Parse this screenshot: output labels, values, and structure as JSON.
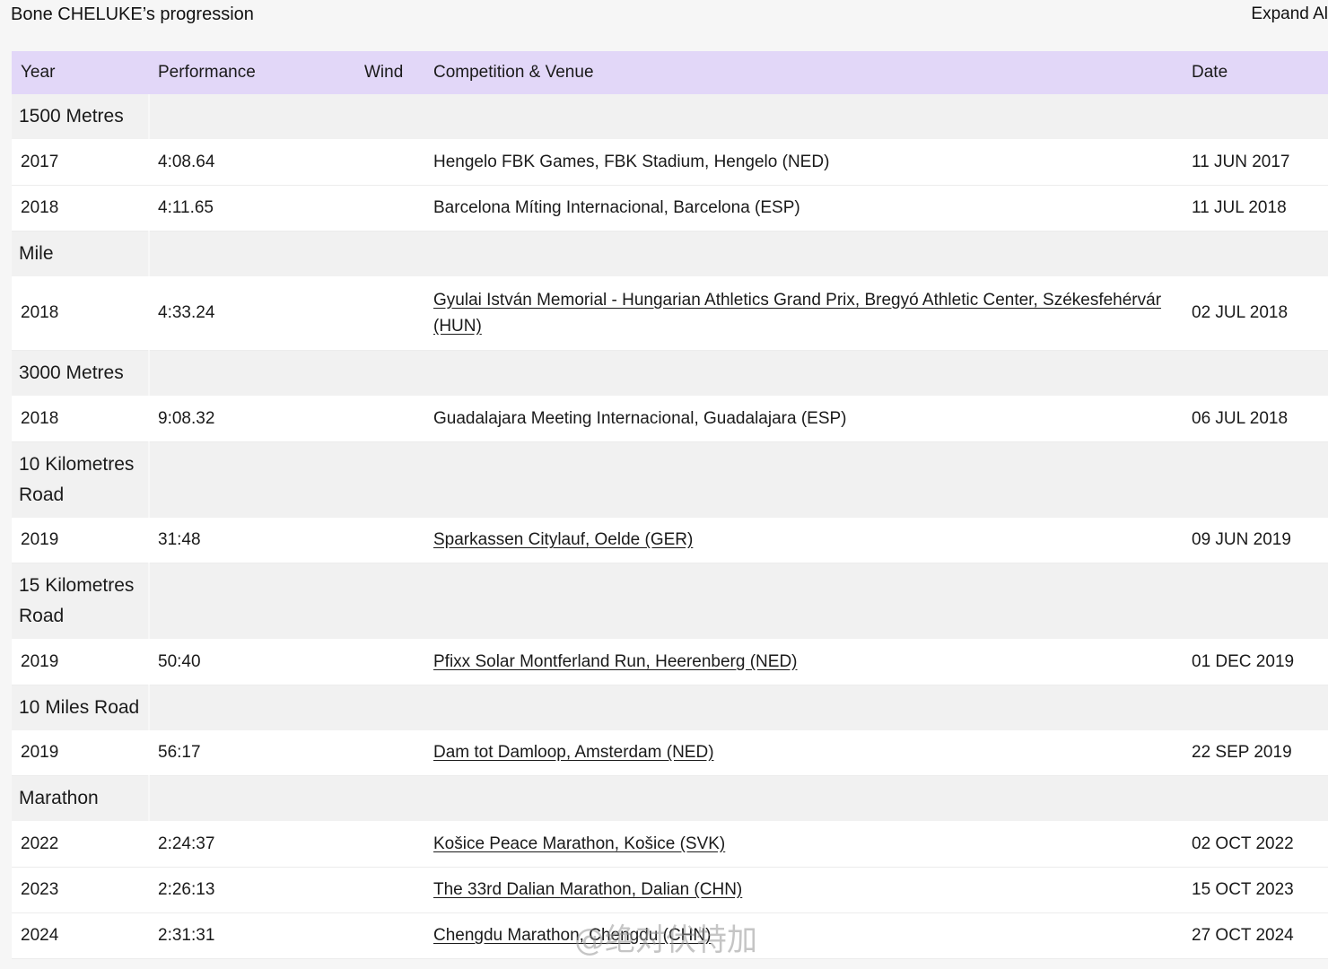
{
  "header": {
    "title": "Bone CHELUKE’s progression",
    "expand_label": "Expand Al"
  },
  "table": {
    "columns": [
      "Year",
      "Performance",
      "Wind",
      "Competition & Venue",
      "Date"
    ],
    "groups": [
      {
        "event": "1500 Metres",
        "rows": [
          {
            "year": "2017",
            "performance": "4:08.64",
            "wind": "",
            "venue": "Hengelo FBK Games, FBK Stadium, Hengelo (NED)",
            "date": "11 JUN 2017",
            "link": false
          },
          {
            "year": "2018",
            "performance": "4:11.65",
            "wind": "",
            "venue": "Barcelona Míting Internacional, Barcelona (ESP)",
            "date": "11 JUL 2018",
            "link": false
          }
        ]
      },
      {
        "event": "Mile",
        "rows": [
          {
            "year": "2018",
            "performance": "4:33.24",
            "wind": "",
            "venue": "Gyulai István Memorial - Hungarian Athletics Grand Prix, Bregyó Athletic Center, Székesfehérvár (HUN)",
            "date": "02 JUL 2018",
            "link": true
          }
        ]
      },
      {
        "event": "3000 Metres",
        "rows": [
          {
            "year": "2018",
            "performance": "9:08.32",
            "wind": "",
            "venue": "Guadalajara Meeting Internacional, Guadalajara (ESP)",
            "date": "06 JUL 2018",
            "link": false
          }
        ]
      },
      {
        "event": "10 Kilometres Road",
        "rows": [
          {
            "year": "2019",
            "performance": "31:48",
            "wind": "",
            "venue": "Sparkassen Citylauf, Oelde (GER)",
            "date": "09 JUN 2019",
            "link": true
          }
        ]
      },
      {
        "event": "15 Kilometres Road",
        "rows": [
          {
            "year": "2019",
            "performance": "50:40",
            "wind": "",
            "venue": "Pfixx Solar Montferland Run, Heerenberg (NED)",
            "date": "01 DEC 2019",
            "link": true
          }
        ]
      },
      {
        "event": "10 Miles Road",
        "rows": [
          {
            "year": "2019",
            "performance": "56:17",
            "wind": "",
            "venue": "Dam tot Damloop, Amsterdam (NED)",
            "date": "22 SEP 2019",
            "link": true
          }
        ]
      },
      {
        "event": "Marathon",
        "rows": [
          {
            "year": "2022",
            "performance": "2:24:37",
            "wind": "",
            "venue": "Košice Peace Marathon, Košice (SVK)",
            "date": "02 OCT 2022",
            "link": true
          },
          {
            "year": "2023",
            "performance": "2:26:13",
            "wind": "",
            "venue": "The 33rd Dalian Marathon, Dalian (CHN)",
            "date": "15 OCT 2023",
            "link": true
          },
          {
            "year": "2024",
            "performance": "2:31:31",
            "wind": "",
            "venue": "Chengdu Marathon, Chengdu (CHN)",
            "date": "27 OCT 2024",
            "link": true
          }
        ]
      }
    ]
  },
  "watermark": "@绝对伏特加",
  "colors": {
    "header_bg": "#e2d7f8",
    "group_bg": "#f1f1f1",
    "row_bg": "#ffffff",
    "page_bg": "#f6f6f6"
  }
}
